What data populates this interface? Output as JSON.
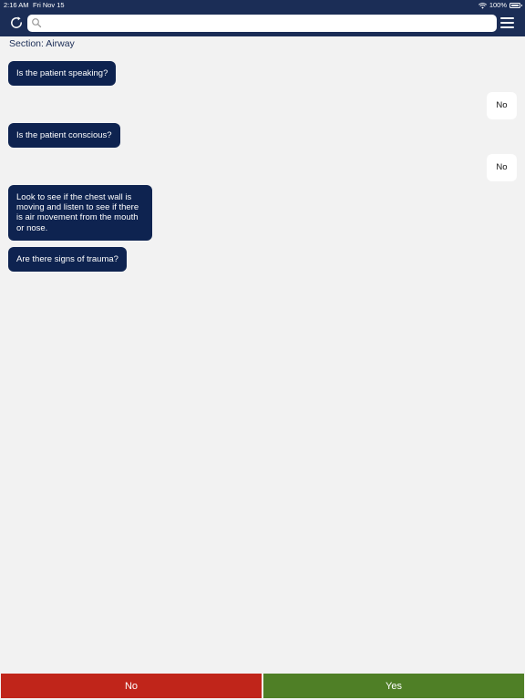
{
  "status_bar": {
    "time": "2:16 AM",
    "date": "Fri Nov 15",
    "battery": "100%"
  },
  "search": {
    "value": "",
    "placeholder": ""
  },
  "section": {
    "title": "Section: Airway"
  },
  "chat": [
    {
      "role": "question",
      "text": "Is the patient speaking?"
    },
    {
      "role": "answer",
      "text": "No"
    },
    {
      "role": "question",
      "text": "Is the patient conscious?"
    },
    {
      "role": "answer",
      "text": "No"
    },
    {
      "role": "question",
      "text": "Look to see if the chest wall is moving and listen to see if there is air movement from the mouth or nose."
    },
    {
      "role": "question",
      "text": "Are there signs of trauma?"
    }
  ],
  "actions": {
    "no_label": "No",
    "yes_label": "Yes"
  },
  "colors": {
    "header": "#1b2d56",
    "question_bubble": "#0e2350",
    "no_button": "#c0251a",
    "yes_button": "#4f7f26",
    "background": "#f2f2f2"
  }
}
